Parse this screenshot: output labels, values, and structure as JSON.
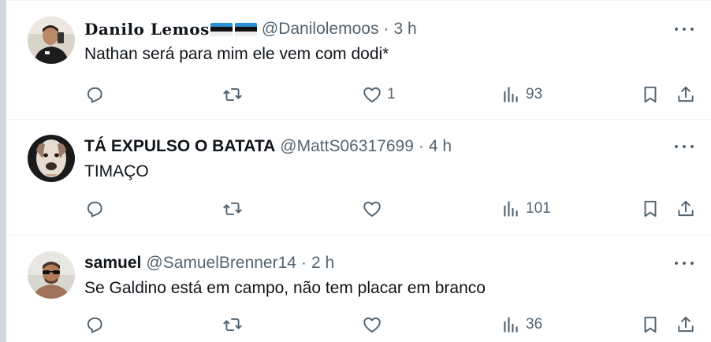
{
  "tweets": [
    {
      "display_name": "Danilo Lemos",
      "handle": "@Danilolemoos",
      "separator": "·",
      "time": "3 h",
      "text": "Nathan  será para mim ele vem com dodi*",
      "replies": "",
      "retweets": "",
      "likes": "1",
      "views": "93"
    },
    {
      "display_name": "TÁ EXPULSO O BATATA",
      "handle": "@MattS06317699",
      "separator": "·",
      "time": "4 h",
      "text": "TIMAÇO",
      "replies": "",
      "retweets": "",
      "likes": "",
      "views": "101"
    },
    {
      "display_name": "samuel",
      "handle": "@SamuelBrenner14",
      "separator": "·",
      "time": "2 h",
      "text": "Se Galdino está em campo, não tem placar em branco",
      "replies": "",
      "retweets": "",
      "likes": "",
      "views": "36"
    }
  ],
  "icons": {
    "reply": "reply-icon",
    "retweet": "retweet-icon",
    "like": "heart-icon",
    "views": "views-icon",
    "bookmark": "bookmark-icon",
    "share": "share-icon",
    "more": "more-icon"
  },
  "colors": {
    "text_primary": "#0f1419",
    "text_secondary": "#536471",
    "divider": "#eff3f4"
  }
}
